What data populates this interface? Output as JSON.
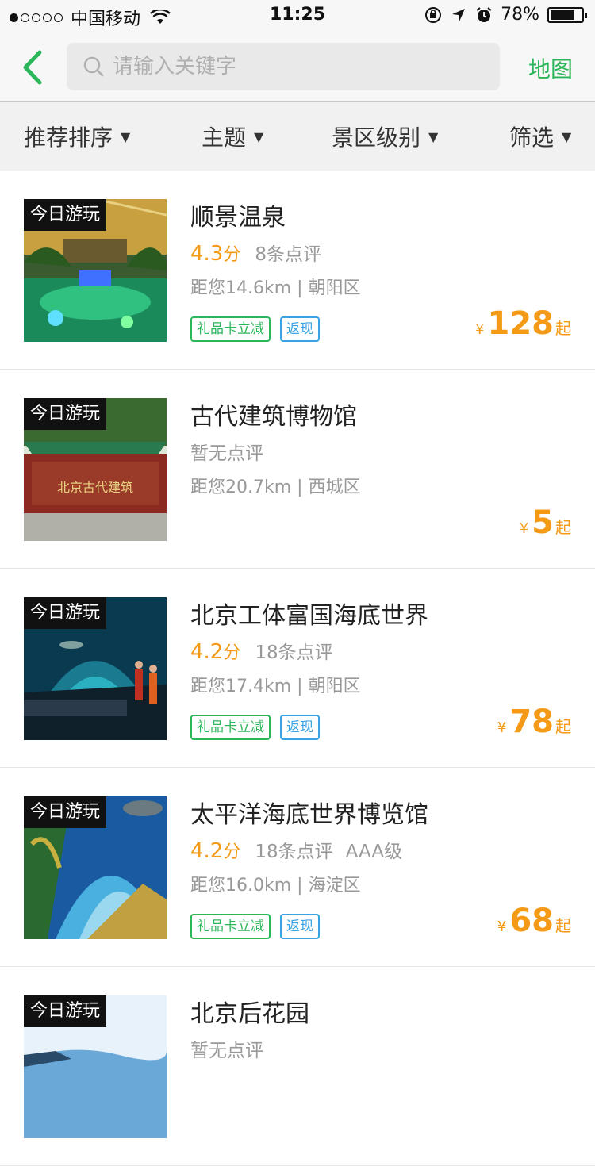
{
  "status": {
    "carrier": "中国移动",
    "time": "11:25",
    "battery": "78%",
    "battery_level": 0.78
  },
  "nav": {
    "search_placeholder": "请输入关键字",
    "map_label": "地图"
  },
  "filters": [
    {
      "label": "推荐排序"
    },
    {
      "label": "主题"
    },
    {
      "label": "景区级别"
    },
    {
      "label": "筛选"
    }
  ],
  "items": [
    {
      "badge": "今日游玩",
      "title": "顺景温泉",
      "score": "4.3",
      "score_unit": "分",
      "reviews": "8条点评",
      "level": "",
      "distance": "距您14.6km",
      "district": "朝阳区",
      "tags": [
        "礼品卡立减",
        "返现"
      ],
      "yen": "¥",
      "price": "128",
      "price_suffix": "起",
      "colors": [
        "#1a4a2a",
        "#c8a040",
        "#20a070"
      ]
    },
    {
      "badge": "今日游玩",
      "title": "古代建筑博物馆",
      "no_review": "暂无点评",
      "distance": "距您20.7km",
      "district": "西城区",
      "yen": "¥",
      "price": "5",
      "price_suffix": "起",
      "colors": [
        "#2a5020",
        "#8a2a20",
        "#9a9a8a"
      ]
    },
    {
      "badge": "今日游玩",
      "title": "北京工体富国海底世界",
      "score": "4.2",
      "score_unit": "分",
      "reviews": "18条点评",
      "level": "",
      "distance": "距您17.4km",
      "district": "朝阳区",
      "tags": [
        "礼品卡立减",
        "返现"
      ],
      "yen": "¥",
      "price": "78",
      "price_suffix": "起",
      "colors": [
        "#0a3a50",
        "#2a90a0",
        "#101820"
      ]
    },
    {
      "badge": "今日游玩",
      "title": "太平洋海底世界博览馆",
      "score": "4.2",
      "score_unit": "分",
      "reviews": "18条点评",
      "level": "AAA级",
      "distance": "距您16.0km",
      "district": "海淀区",
      "tags": [
        "礼品卡立减",
        "返现"
      ],
      "yen": "¥",
      "price": "68",
      "price_suffix": "起",
      "colors": [
        "#1a5aa0",
        "#4ab0e0",
        "#c0a040"
      ]
    },
    {
      "badge": "今日游玩",
      "title": "北京后花园",
      "no_review": "暂无点评",
      "colors": [
        "#6aa8d8",
        "#e8f2fa",
        "#2a4a6a"
      ]
    }
  ]
}
